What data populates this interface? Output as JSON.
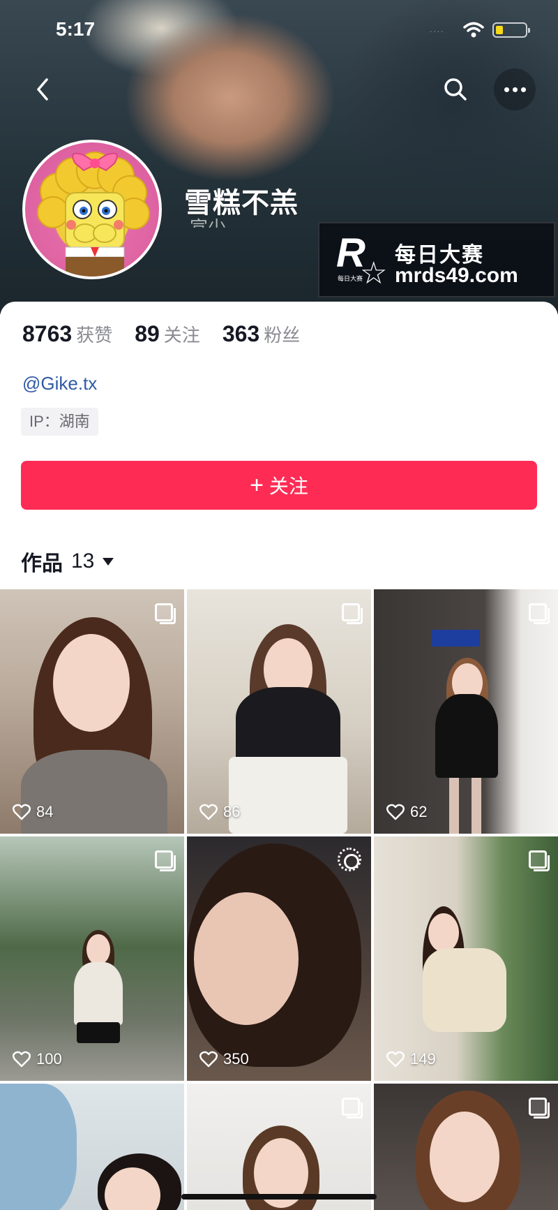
{
  "status_bar": {
    "time": "5:17"
  },
  "header": {
    "nickname": "雪糕不羔",
    "subtitle_partial": "宣少"
  },
  "watermark": {
    "title": "每日大赛",
    "url": "mrds49.com",
    "logo_letter": "R",
    "logo_small_text": "每日大赛"
  },
  "stats": [
    {
      "value": "8763",
      "label": "获赞"
    },
    {
      "value": "89",
      "label": "关注"
    },
    {
      "value": "363",
      "label": "粉丝"
    }
  ],
  "profile": {
    "handle": "@Gike.tx",
    "ip": "IP：湖南"
  },
  "follow_button": {
    "label": "关注",
    "icon": "plus-icon"
  },
  "works_tab": {
    "label": "作品",
    "count": "13"
  },
  "colors": {
    "accent": "#fe2c55",
    "link": "#2f5aa5",
    "muted": "#8a8b91"
  },
  "posts": [
    {
      "likes": "84",
      "badge": "multi-image-icon"
    },
    {
      "likes": "86",
      "badge": "multi-image-icon"
    },
    {
      "likes": "62",
      "badge": "multi-image-icon"
    },
    {
      "likes": "100",
      "badge": "multi-image-icon"
    },
    {
      "likes": "350",
      "badge": "live-photo-icon"
    },
    {
      "likes": "149",
      "badge": "multi-image-icon"
    },
    {
      "likes": "",
      "badge": "none"
    },
    {
      "likes": "",
      "badge": "multi-image-icon"
    },
    {
      "likes": "",
      "badge": "multi-image-icon"
    }
  ]
}
